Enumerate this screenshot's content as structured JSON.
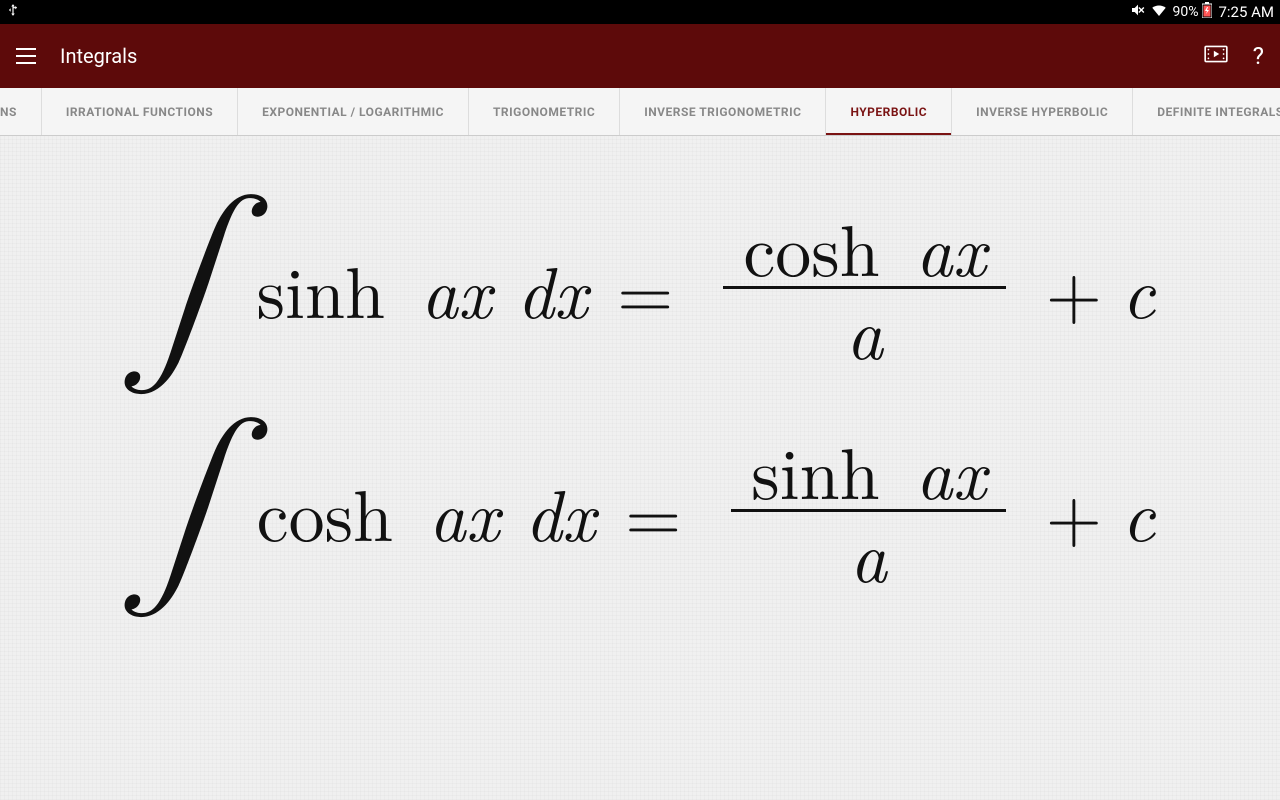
{
  "status": {
    "battery_pct": "90%",
    "time": "7:25 AM"
  },
  "header": {
    "title": "Integrals"
  },
  "tabs": {
    "fragment_left": "NS",
    "items": [
      "IRRATIONAL FUNCTIONS",
      "EXPONENTIAL / LOGARITHMIC",
      "TRIGONOMETRIC",
      "INVERSE TRIGONOMETRIC",
      "HYPERBOLIC",
      "INVERSE HYPERBOLIC",
      "DEFINITE INTEGRALS"
    ],
    "active_index": 4
  },
  "formulas": [
    {
      "integrand_func": "sinh",
      "integrand_tail": "ax dx",
      "numerator_func": "cosh",
      "numerator_tail": "ax",
      "denominator": "a",
      "constant": "c"
    },
    {
      "integrand_func": "cosh",
      "integrand_tail": "ax dx",
      "numerator_func": "sinh",
      "numerator_tail": "ax",
      "denominator": "a",
      "constant": "c"
    }
  ]
}
